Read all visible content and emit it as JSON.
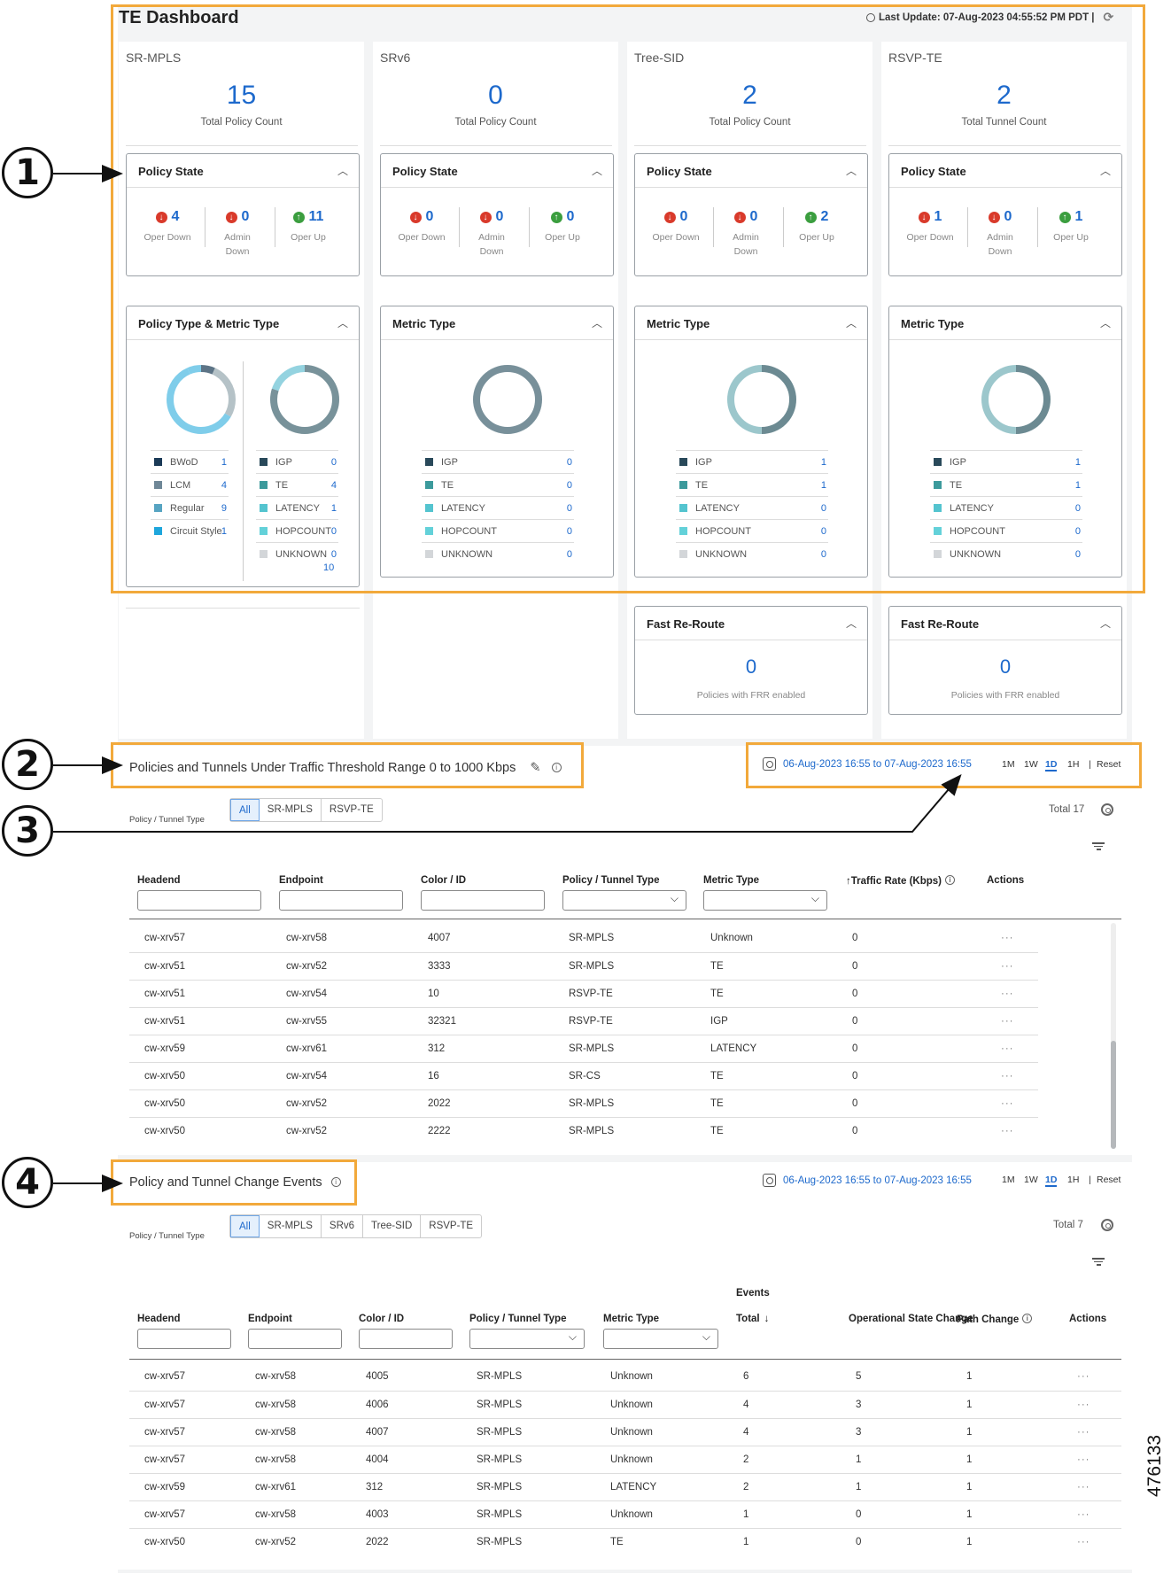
{
  "dashboard": {
    "title": "TE Dashboard",
    "last_update": "Last Update: 07-Aug-2023 04:55:52 PM PDT |"
  },
  "callouts": [
    "1",
    "2",
    "3",
    "4"
  ],
  "figure_number": "476133",
  "columns": [
    {
      "name": "SR-MPLS",
      "count": "15",
      "count_label": "Total Policy Count",
      "policy_state_title": "Policy State",
      "oper_down": "4",
      "admin_down": "0",
      "oper_up": "11",
      "metric_title": "Policy Type & Metric Type",
      "policy_types": [
        {
          "name": "BWoD",
          "value": "1",
          "color": "#1b3a57"
        },
        {
          "name": "LCM",
          "value": "4",
          "color": "#6f8797"
        },
        {
          "name": "Regular",
          "value": "9",
          "color": "#57a4c2"
        },
        {
          "name": "Circuit Style",
          "value": "1",
          "color": "#1ea6dc"
        }
      ],
      "metrics": [
        {
          "name": "IGP",
          "value": "0",
          "color": "#29495a"
        },
        {
          "name": "TE",
          "value": "4",
          "color": "#3c9a9c"
        },
        {
          "name": "LATENCY",
          "value": "1",
          "color": "#54c4cf"
        },
        {
          "name": "HOPCOUNT",
          "value": "0",
          "color": "#63d1d9"
        },
        {
          "name": "UNKNOWN",
          "value": "0",
          "color": "#d3d6d9"
        }
      ],
      "extra_value": "10"
    },
    {
      "name": "SRv6",
      "count": "0",
      "count_label": "Total Policy Count",
      "policy_state_title": "Policy State",
      "oper_down": "0",
      "admin_down": "0",
      "oper_up": "0",
      "metric_title": "Metric Type",
      "metrics": [
        {
          "name": "IGP",
          "value": "0",
          "color": "#29495a"
        },
        {
          "name": "TE",
          "value": "0",
          "color": "#3c9a9c"
        },
        {
          "name": "LATENCY",
          "value": "0",
          "color": "#54c4cf"
        },
        {
          "name": "HOPCOUNT",
          "value": "0",
          "color": "#63d1d9"
        },
        {
          "name": "UNKNOWN",
          "value": "0",
          "color": "#d3d6d9"
        }
      ]
    },
    {
      "name": "Tree-SID",
      "count": "2",
      "count_label": "Total Policy Count",
      "policy_state_title": "Policy State",
      "oper_down": "0",
      "admin_down": "0",
      "oper_up": "2",
      "metric_title": "Metric Type",
      "metrics": [
        {
          "name": "IGP",
          "value": "1",
          "color": "#29495a"
        },
        {
          "name": "TE",
          "value": "1",
          "color": "#3c9a9c"
        },
        {
          "name": "LATENCY",
          "value": "0",
          "color": "#54c4cf"
        },
        {
          "name": "HOPCOUNT",
          "value": "0",
          "color": "#63d1d9"
        },
        {
          "name": "UNKNOWN",
          "value": "0",
          "color": "#d3d6d9"
        }
      ],
      "frr_title": "Fast Re-Route",
      "frr_count": "0",
      "frr_label": "Policies with FRR enabled"
    },
    {
      "name": "RSVP-TE",
      "count": "2",
      "count_label": "Total Tunnel Count",
      "policy_state_title": "Policy State",
      "oper_down": "1",
      "admin_down": "0",
      "oper_up": "1",
      "metric_title": "Metric Type",
      "metrics": [
        {
          "name": "IGP",
          "value": "1",
          "color": "#29495a"
        },
        {
          "name": "TE",
          "value": "1",
          "color": "#3c9a9c"
        },
        {
          "name": "LATENCY",
          "value": "0",
          "color": "#54c4cf"
        },
        {
          "name": "HOPCOUNT",
          "value": "0",
          "color": "#63d1d9"
        },
        {
          "name": "UNKNOWN",
          "value": "0",
          "color": "#d3d6d9"
        }
      ],
      "frr_title": "Fast Re-Route",
      "frr_count": "0",
      "frr_label": "Policies with FRR enabled"
    }
  ],
  "labels": {
    "oper_down": "Oper Down",
    "admin": "Admin",
    "down": "Down",
    "oper_up": "Oper Up"
  },
  "threshold": {
    "title": "Policies and Tunnels Under Traffic Threshold Range 0 to 1000 Kbps",
    "range": "06-Aug-2023 16:55 to 07-Aug-2023 16:55",
    "time_buttons": [
      "1M",
      "1W",
      "1D",
      "1H"
    ],
    "reset": "Reset",
    "type_label": "Policy / Tunnel Type",
    "tabs": [
      "All",
      "SR-MPLS",
      "RSVP-TE"
    ],
    "total": "Total 17",
    "headers": [
      "Headend",
      "Endpoint",
      "Color / ID",
      "Policy / Tunnel Type",
      "Metric Type",
      "Traffic Rate (Kbps)",
      "Actions"
    ],
    "sort_arrow": "↑",
    "rows": [
      [
        "cw-xrv57",
        "cw-xrv58",
        "4007",
        "SR-MPLS",
        "Unknown",
        "0"
      ],
      [
        "cw-xrv51",
        "cw-xrv52",
        "3333",
        "SR-MPLS",
        "TE",
        "0"
      ],
      [
        "cw-xrv51",
        "cw-xrv54",
        "10",
        "RSVP-TE",
        "TE",
        "0"
      ],
      [
        "cw-xrv51",
        "cw-xrv55",
        "32321",
        "RSVP-TE",
        "IGP",
        "0"
      ],
      [
        "cw-xrv59",
        "cw-xrv61",
        "312",
        "SR-MPLS",
        "LATENCY",
        "0"
      ],
      [
        "cw-xrv50",
        "cw-xrv54",
        "16",
        "SR-CS",
        "TE",
        "0"
      ],
      [
        "cw-xrv50",
        "cw-xrv52",
        "2022",
        "SR-MPLS",
        "TE",
        "0"
      ],
      [
        "cw-xrv50",
        "cw-xrv52",
        "2222",
        "SR-MPLS",
        "TE",
        "0"
      ]
    ]
  },
  "events": {
    "title": "Policy and Tunnel Change Events",
    "range": "06-Aug-2023 16:55 to 07-Aug-2023 16:55",
    "time_buttons": [
      "1M",
      "1W",
      "1D",
      "1H"
    ],
    "reset": "Reset",
    "type_label": "Policy / Tunnel Type",
    "tabs": [
      "All",
      "SR-MPLS",
      "SRv6",
      "Tree-SID",
      "RSVP-TE"
    ],
    "total": "Total 7",
    "group_header": "Events",
    "headers": [
      "Headend",
      "Endpoint",
      "Color / ID",
      "Policy / Tunnel Type",
      "Metric Type",
      "Total",
      "Operational State Change",
      "Path Change",
      "Actions"
    ],
    "sort_arrow": "↓",
    "rows": [
      [
        "cw-xrv57",
        "cw-xrv58",
        "4005",
        "SR-MPLS",
        "Unknown",
        "6",
        "5",
        "1"
      ],
      [
        "cw-xrv57",
        "cw-xrv58",
        "4006",
        "SR-MPLS",
        "Unknown",
        "4",
        "3",
        "1"
      ],
      [
        "cw-xrv57",
        "cw-xrv58",
        "4007",
        "SR-MPLS",
        "Unknown",
        "4",
        "3",
        "1"
      ],
      [
        "cw-xrv57",
        "cw-xrv58",
        "4004",
        "SR-MPLS",
        "Unknown",
        "2",
        "1",
        "1"
      ],
      [
        "cw-xrv59",
        "cw-xrv61",
        "312",
        "SR-MPLS",
        "LATENCY",
        "2",
        "1",
        "1"
      ],
      [
        "cw-xrv57",
        "cw-xrv58",
        "4003",
        "SR-MPLS",
        "Unknown",
        "1",
        "0",
        "1"
      ],
      [
        "cw-xrv50",
        "cw-xrv52",
        "2022",
        "SR-MPLS",
        "TE",
        "1",
        "0",
        "1"
      ]
    ]
  }
}
